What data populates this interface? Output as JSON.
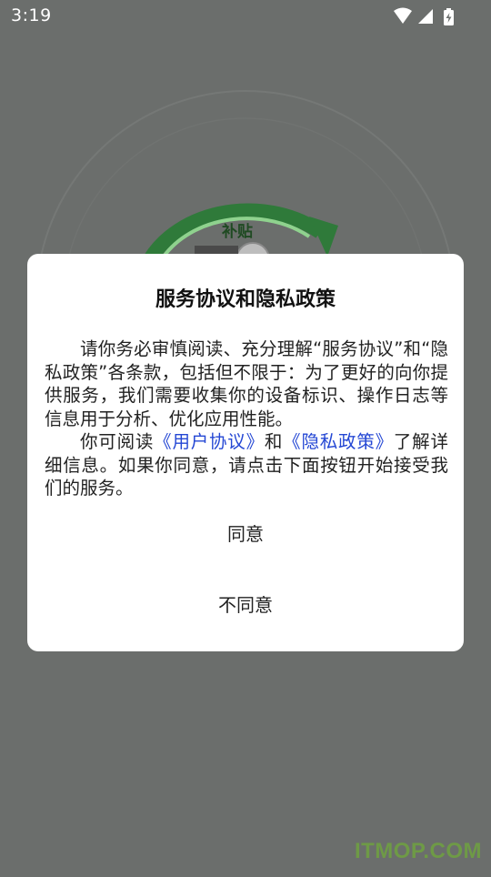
{
  "status_bar": {
    "time": "3:19",
    "icons": [
      "wifi-icon",
      "cellular-signal-icon",
      "battery-charging-icon"
    ]
  },
  "background": {
    "subsidy_label": "补贴"
  },
  "dialog": {
    "title": "服务协议和隐私政策",
    "paragraph1": "请你务必审慎阅读、充分理解“服务协议”和“隐私政策”各条款，包括但不限于：为了更好的向你提供服务，我们需要收集你的设备标识、操作日志等信息用于分析、优化应用性能。",
    "paragraph2_prefix": "你可阅读",
    "user_agreement_link": "《用户协议》",
    "paragraph2_and": "和",
    "privacy_policy_link": "《隐私政策》",
    "paragraph2_suffix": "了解详细信息。如果你同意，请点击下面按钮开始接受我们的服务。",
    "agree_button": "同意",
    "disagree_button": "不同意"
  },
  "watermark": "ITMOP.COM",
  "colors": {
    "overlay": "#6b6e6c",
    "link": "#2447d4",
    "dialog_bg": "#ffffff",
    "art_green": "#2f7a3a"
  }
}
